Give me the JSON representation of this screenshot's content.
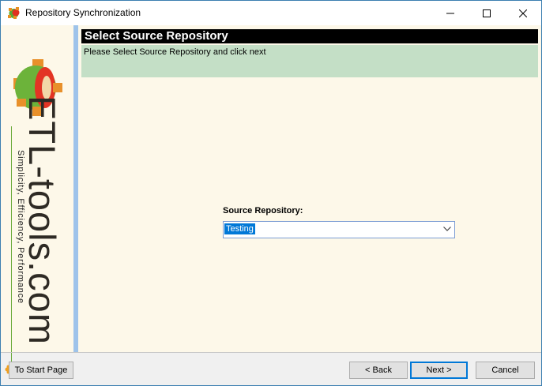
{
  "window": {
    "title": "Repository Synchronization"
  },
  "brand": {
    "name": "ETL-tools.com",
    "tagline": "Simplicity, Efficiency, Performance"
  },
  "header": {
    "title": "Select Source Repository",
    "subtitle": "Please Select Source Repository and click next"
  },
  "form": {
    "source_label": "Source Repository:",
    "source_value": "Testing"
  },
  "buttons": {
    "start_page": "To Start Page",
    "back": "< Back",
    "next": "Next >",
    "cancel": "Cancel"
  },
  "colors": {
    "header_black": "#000000",
    "header_green": "#c4dfc6",
    "panel_bg": "#fdf8e9",
    "accent": "#0078d7"
  }
}
